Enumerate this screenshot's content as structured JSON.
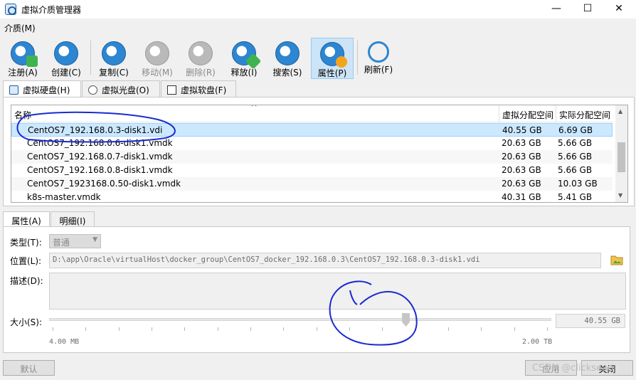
{
  "window": {
    "title": "虚拟介质管理器",
    "minimize_glyph": "—",
    "maximize_glyph": "☐",
    "close_glyph": "✕"
  },
  "menu": {
    "items": [
      "介质(M)"
    ]
  },
  "toolbar": {
    "buttons": [
      {
        "label": "注册(A)",
        "icon": "register-icon",
        "enabled": true
      },
      {
        "label": "创建(C)",
        "icon": "create-icon",
        "enabled": true
      },
      {
        "label": "复制(C)",
        "icon": "copy-icon",
        "enabled": true
      },
      {
        "label": "移动(M)",
        "icon": "move-icon",
        "enabled": false
      },
      {
        "label": "删除(R)",
        "icon": "delete-icon",
        "enabled": false
      },
      {
        "label": "释放(I)",
        "icon": "release-icon",
        "enabled": true
      },
      {
        "label": "搜索(S)",
        "icon": "search-icon",
        "enabled": true
      },
      {
        "label": "属性(P)",
        "icon": "properties-icon",
        "enabled": true,
        "active": true
      },
      {
        "label": "刷新(F)",
        "icon": "refresh-icon",
        "enabled": true
      }
    ]
  },
  "media_tabs": [
    {
      "label": "虚拟硬盘(H)",
      "icon": "hard-disk-icon",
      "active": true
    },
    {
      "label": "虚拟光盘(O)",
      "icon": "optical-disk-icon",
      "active": false
    },
    {
      "label": "虚拟软盘(F)",
      "icon": "floppy-disk-icon",
      "active": false
    }
  ],
  "list": {
    "sort_indicator": "^",
    "columns": [
      "名称",
      "虚拟分配空间",
      "实际分配空间"
    ],
    "rows": [
      {
        "name": "CentOS7_192.168.0.3-disk1.vdi",
        "virtual": "40.55 GB",
        "actual": "6.69 GB",
        "selected": true
      },
      {
        "name": "CentOS7_192.168.0.6-disk1.vmdk",
        "virtual": "20.63 GB",
        "actual": "5.66 GB"
      },
      {
        "name": "CentOS7_192.168.0.7-disk1.vmdk",
        "virtual": "20.63 GB",
        "actual": "5.66 GB"
      },
      {
        "name": "CentOS7_192.168.0.8-disk1.vmdk",
        "virtual": "20.63 GB",
        "actual": "5.66 GB"
      },
      {
        "name": "CentOS7_1923168.0.50-disk1.vmdk",
        "virtual": "20.63 GB",
        "actual": "10.03 GB"
      },
      {
        "name": "k8s-master.vmdk",
        "virtual": "40.31 GB",
        "actual": "5.41 GB"
      }
    ]
  },
  "detail_tabs": [
    {
      "label": "属性(A)",
      "active": true
    },
    {
      "label": "明细(I)",
      "active": false
    }
  ],
  "properties": {
    "type_label": "类型(T):",
    "type_value": "普通",
    "location_label": "位置(L):",
    "location_value": "D:\\app\\Oracle\\virtualHost\\docker_group\\CentOS7_docker_192.168.0.3\\CentOS7_192.168.0.3-disk1.vdi",
    "description_label": "描述(D):",
    "description_value": "",
    "size_label": "大小(S):",
    "size_value": "40.55 GB",
    "size_min": "4.00 MB",
    "size_max": "2.00 TB",
    "size_fraction": 0.71
  },
  "buttons": {
    "reset": "默认",
    "apply": "应用",
    "close": "关闭"
  },
  "watermark": "CSDN @clickseao"
}
